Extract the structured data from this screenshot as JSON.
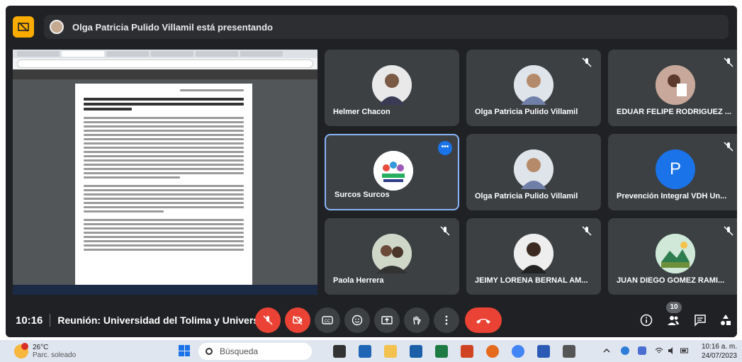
{
  "presenter_bar": {
    "text": "Olga Patricia Pulido Villamil está presentando"
  },
  "tiles": [
    {
      "name": "Helmer Chacon",
      "muted": false
    },
    {
      "name": "Olga Patricia Pulido Villamil",
      "muted": true
    },
    {
      "name": "EDUAR FELIPE RODRIGUEZ ...",
      "muted": true
    },
    {
      "name": "Surcos Surcos",
      "muted": false,
      "selected": true
    },
    {
      "name": "Olga Patricia Pulido Villamil",
      "muted": false
    },
    {
      "name": "Prevención Integral VDH Un...",
      "muted": true,
      "initial": "P"
    },
    {
      "name": "Paola Herrera",
      "muted": true
    },
    {
      "name": "JEIMY LORENA BERNAL AM...",
      "muted": true
    },
    {
      "name": "JUAN DIEGO GOMEZ RAMI...",
      "muted": true
    }
  ],
  "bottom": {
    "time": "10:16",
    "meeting_name": "Reunión: Universidad del Tolima y Universi...",
    "participants_count": "10"
  },
  "taskbar": {
    "temperature": "26°C",
    "condition": "Parc. soleado",
    "search_placeholder": "Búsqueda",
    "clock_time": "10:16 a. m.",
    "clock_date": "24/07/2023"
  },
  "colors": {
    "background": "#202124",
    "tile": "#3c4043",
    "accent_blue": "#1a73e8",
    "red": "#ea4335",
    "present_yellow": "#f9ab00"
  }
}
